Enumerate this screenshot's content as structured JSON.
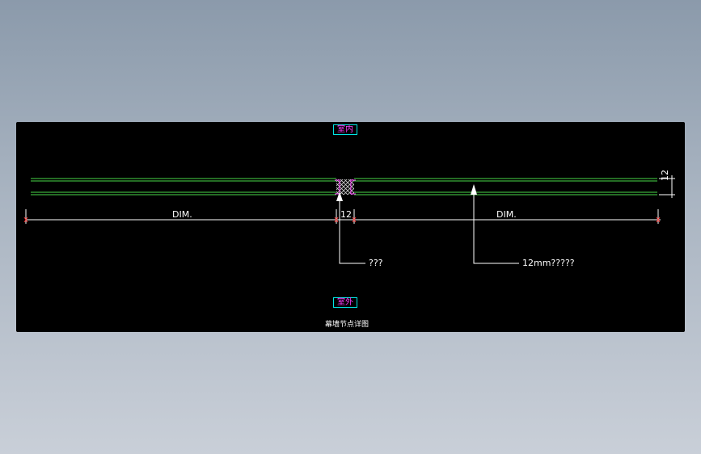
{
  "drawing": {
    "label_top": "室内",
    "label_bottom": "室外",
    "dim_left": "DIM.",
    "dim_mid": "12",
    "dim_right": "DIM.",
    "dim_vertical": "12",
    "callout_left": "???",
    "callout_right": "12mm?????",
    "title": "幕墙节点详图"
  },
  "colors": {
    "background": "#000000",
    "glass_line": "#49d949",
    "dim_line": "#ffffff",
    "dim_endpoint": "#ff3030",
    "tag_border": "#00e5e5",
    "tag_text": "#ff3cff"
  }
}
